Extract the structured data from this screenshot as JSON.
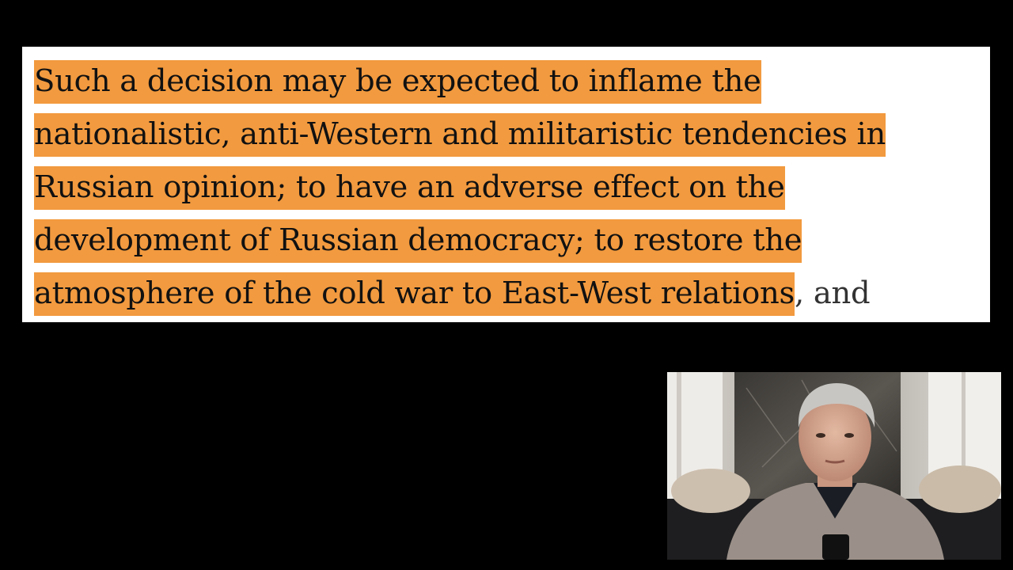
{
  "quote": {
    "highlighted_lines": [
      "Such a decision may be expected to inflame the",
      "nationalistic, anti-Western and militaristic tendencies in",
      "Russian opinion; to have an adverse effect on the",
      "development of Russian democracy; to restore the",
      "atmosphere of the cold war to East-West relations"
    ],
    "trailing_text": ", and"
  },
  "colors": {
    "background": "#000000",
    "card": "#ffffff",
    "highlight": "#f29a3f",
    "text": "#111111"
  }
}
